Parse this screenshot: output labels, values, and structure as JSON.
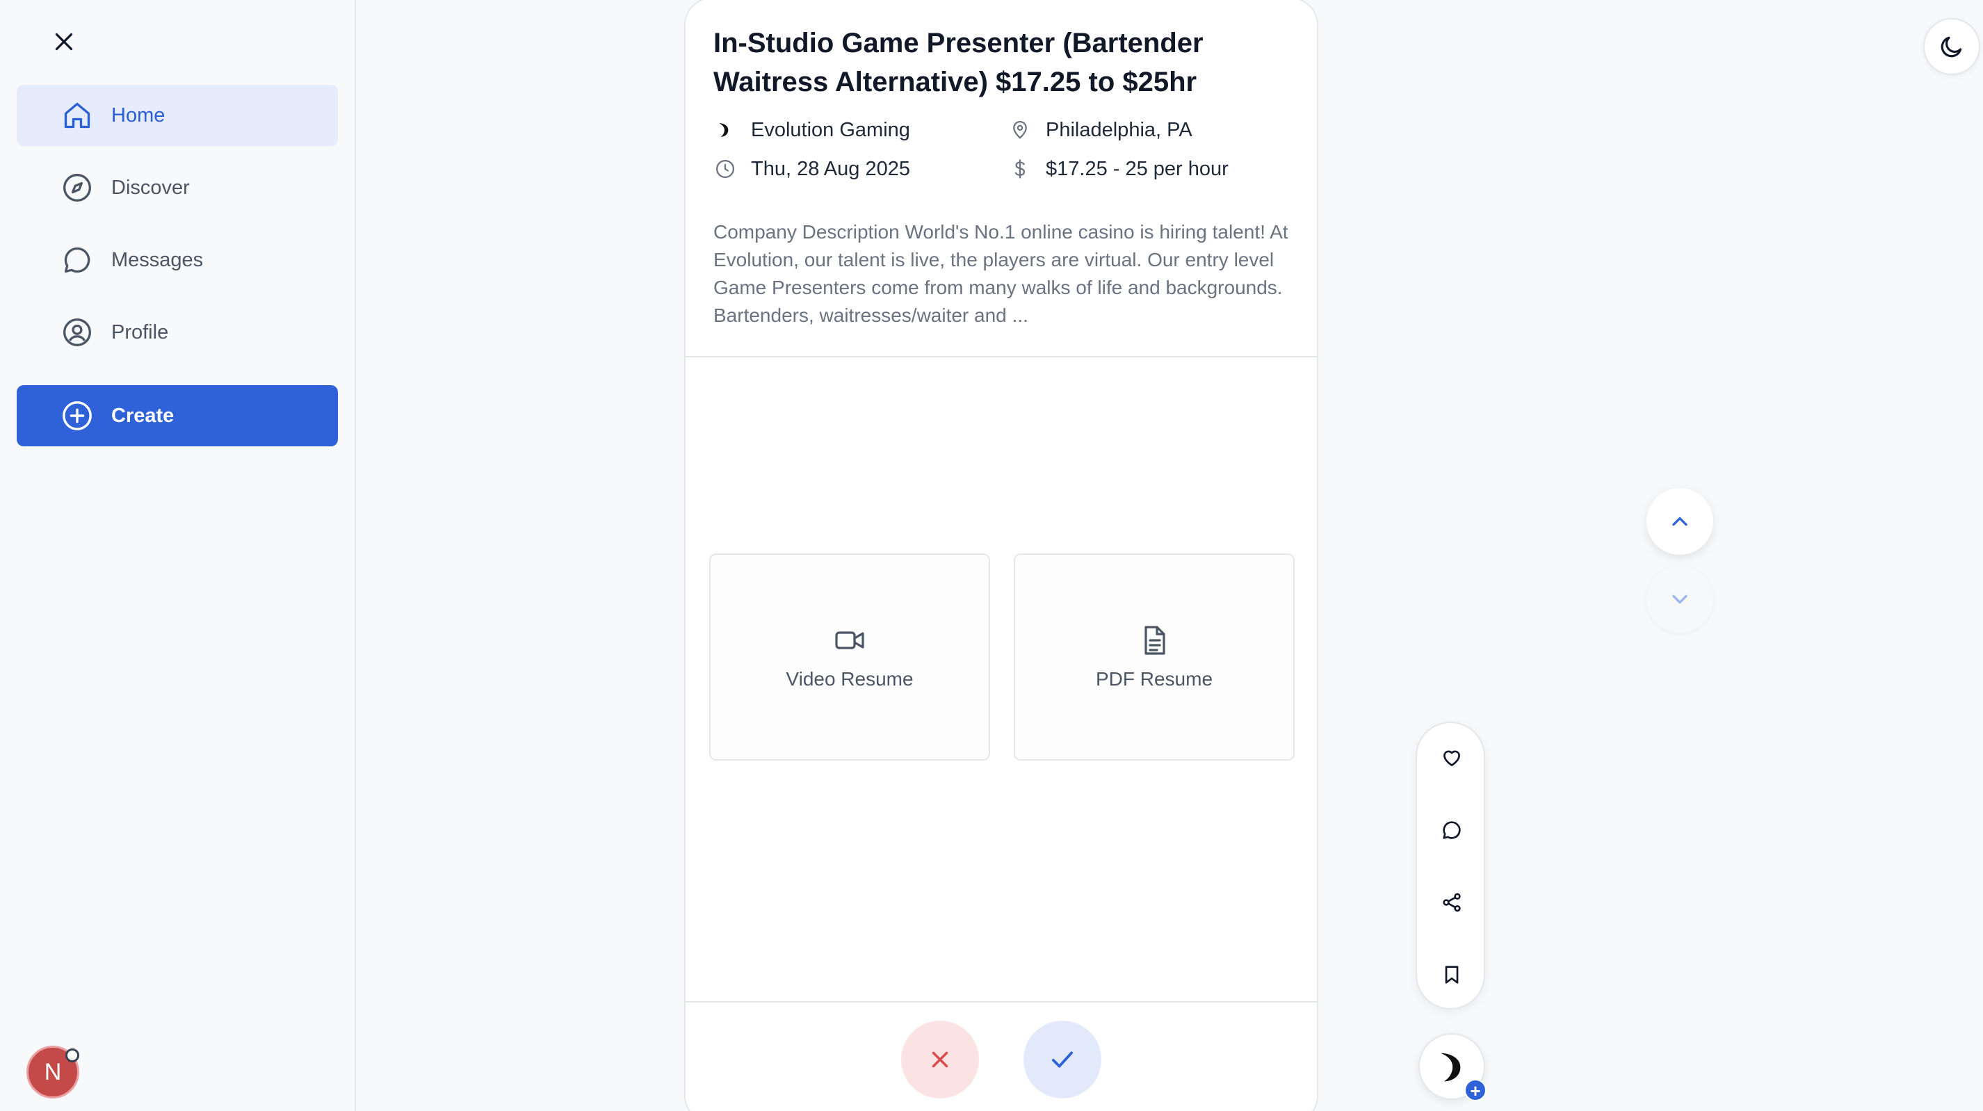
{
  "sidebar": {
    "items": [
      {
        "label": "Home",
        "icon": "home-icon",
        "active": true
      },
      {
        "label": "Discover",
        "icon": "compass-icon"
      },
      {
        "label": "Messages",
        "icon": "message-icon"
      },
      {
        "label": "Profile",
        "icon": "user-circle-icon"
      }
    ],
    "create_label": "Create",
    "avatar_initial": "N"
  },
  "job": {
    "title": "In-Studio Game Presenter (Bartender Waitress Alternative) $17.25 to $25hr",
    "company": "Evolution Gaming",
    "location": "Philadelphia, PA",
    "date": "Thu, 28 Aug 2025",
    "pay": "$17.25 - 25 per hour",
    "description": "Company Description World's No.1 online casino is hiring talent! At Evolution, our talent is live, the players are virtual. Our entry level Game Presenters come from many walks of life and backgrounds. Bartenders, waitresses/waiter and ..."
  },
  "resume": {
    "video_label": "Video Resume",
    "pdf_label": "PDF Resume"
  },
  "actions": {
    "fab_plus": "+"
  },
  "colors": {
    "accent": "#2f62d9",
    "active_bg": "#e6ecfb",
    "reject": "#d94a4a",
    "reject_bg": "#fbe3e3",
    "accept_bg": "#e2e9fb"
  }
}
